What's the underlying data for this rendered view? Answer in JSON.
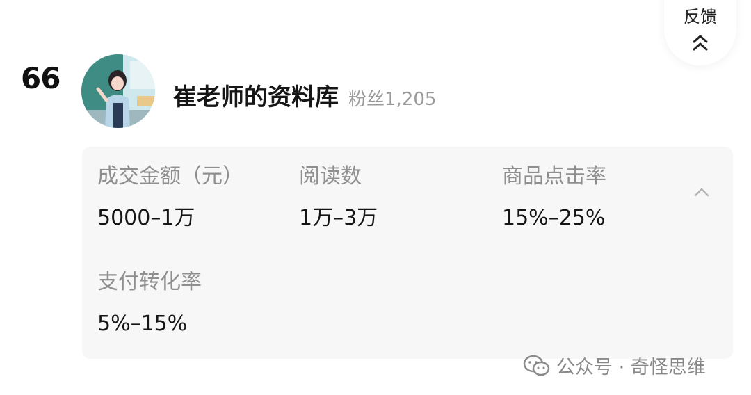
{
  "feedback": {
    "label": "反馈",
    "icon": "double-chevron-up-icon"
  },
  "entry": {
    "rank": "66",
    "avatar": "teacher-avatar",
    "name": "崔老师的资料库",
    "fans": "粉丝1,205"
  },
  "metrics": [
    {
      "label": "成交金额（元）",
      "value": "5000–1万"
    },
    {
      "label": "阅读数",
      "value": "1万–3万"
    },
    {
      "label": "商品点击率",
      "value": "15%–25%"
    },
    {
      "label": "支付转化率",
      "value": "5%–15%"
    }
  ],
  "collapse_icon": "chevron-up-icon",
  "watermark": {
    "text": "公众号 · 奇怪思维",
    "icon": "wechat-icon"
  },
  "colors": {
    "panel_bg": "#f7f7f7",
    "label": "#8f8f8f",
    "value": "#151515",
    "fans": "#9a9a9a"
  }
}
